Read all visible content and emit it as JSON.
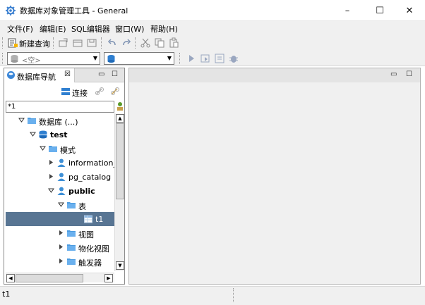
{
  "window": {
    "title": "数据库对象管理工具 - General",
    "minimize": "–",
    "maximize": "☐",
    "close": "✕"
  },
  "menu": {
    "items": [
      "文件(F)",
      "编辑(E)",
      "SQL编辑器",
      "窗口(W)",
      "帮助(H)"
    ]
  },
  "toolbar": {
    "new_query": "新建查询",
    "combo1": "<空>",
    "combo2": ""
  },
  "navigator": {
    "tab_label": "数据库导航",
    "tab_close": "☒",
    "connect_label": "连接",
    "filter_value": "*1"
  },
  "tree": [
    {
      "label": "数据库 (...)",
      "level": 1,
      "expanded": true,
      "icon": "folder-icon",
      "bold": false
    },
    {
      "label": "test",
      "level": 2,
      "expanded": true,
      "icon": "database-icon",
      "bold": true
    },
    {
      "label": "模式",
      "level": 3,
      "expanded": true,
      "icon": "folder-icon",
      "bold": false
    },
    {
      "label": "information_sc",
      "level": 4,
      "expanded": false,
      "icon": "schema-icon",
      "bold": false
    },
    {
      "label": "pg_catalog",
      "level": 4,
      "expanded": false,
      "icon": "schema-icon",
      "bold": false
    },
    {
      "label": "public",
      "level": 4,
      "expanded": true,
      "icon": "schema-icon",
      "bold": true
    },
    {
      "label": "表",
      "level": 5,
      "expanded": true,
      "icon": "folder-icon",
      "bold": false
    },
    {
      "label": "t1",
      "level": 6,
      "expanded": null,
      "icon": "table-icon",
      "bold": false,
      "selected": true
    },
    {
      "label": "视图",
      "level": 5,
      "expanded": false,
      "icon": "folder-icon",
      "bold": false
    },
    {
      "label": "物化视图",
      "level": 5,
      "expanded": false,
      "icon": "folder-icon",
      "bold": false
    },
    {
      "label": "触发器",
      "level": 5,
      "expanded": false,
      "icon": "folder-icon",
      "bold": false
    }
  ],
  "status": {
    "text": "t1"
  },
  "colors": {
    "selection": "#587593",
    "folder": "#4a9be0",
    "schema": "#3d8fd6",
    "db": "#2f7fd0"
  }
}
